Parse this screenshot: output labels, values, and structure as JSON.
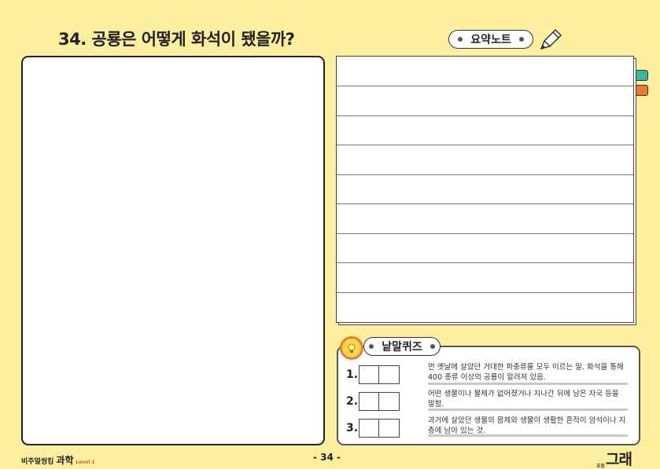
{
  "page": {
    "title": "34. 공룡은 어떻게 화석이 됐을까?",
    "page_number": "- 34 -"
  },
  "summary": {
    "label": "요약노트",
    "line_count": 8
  },
  "quiz": {
    "label": "낱말퀴즈",
    "questions": [
      {
        "number": "1.",
        "clue": "먼 옛날에 살았던 거대한 파충류를 모두 이르는 말. 화석을 통해 400 종류 이상의 공룡이 알려져 있음."
      },
      {
        "number": "2.",
        "clue": "어떤 생물이나 물체가 없어졌거나 지나간 뒤에 남은 자국 등을 말함."
      },
      {
        "number": "3.",
        "clue": "과거에 살았던 생물의 몸체와 생물이 생활한 흔적이 암석이나 지층에 남아 있는 것."
      }
    ]
  },
  "footer": {
    "series": "비주얼씽킹",
    "subject": "과학",
    "level": "Level 1",
    "publisher_small": "초등",
    "publisher": "그래"
  },
  "colors": {
    "background": "#fdeea0",
    "tab_teal": "#3cb8a0",
    "tab_orange": "#ef7a35"
  }
}
